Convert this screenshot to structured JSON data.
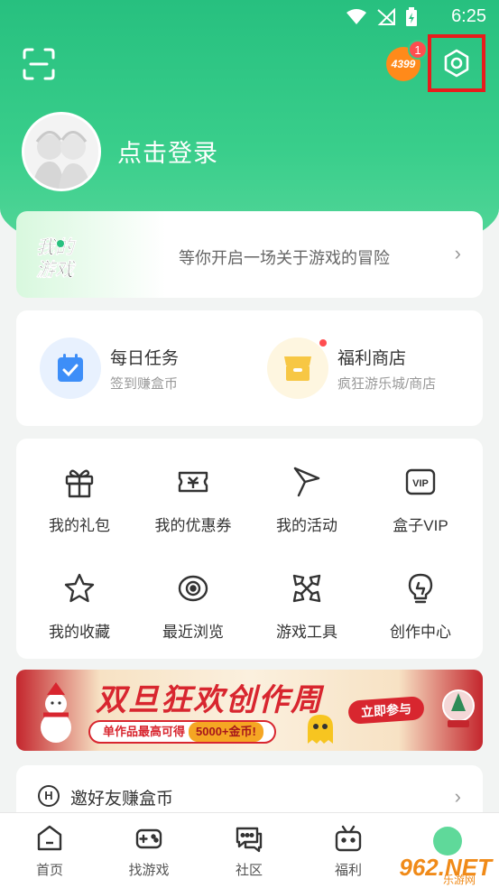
{
  "status_bar": {
    "time": "6:25"
  },
  "header": {
    "brand_logo": "4399",
    "notification_count": "1",
    "login_text": "点击登录"
  },
  "my_game": {
    "logo_text": "我的游戏",
    "tagline": "等你开启一场关于游戏的冒险",
    "chevron": "›"
  },
  "tasks": [
    {
      "title": "每日任务",
      "subtitle": "签到赚盒币",
      "icon": "calendar-check-icon",
      "color": "#3d8ef8"
    },
    {
      "title": "福利商店",
      "subtitle": "疯狂游乐城/商店",
      "icon": "shop-icon",
      "color": "#f7c744"
    }
  ],
  "grid": [
    {
      "label": "我的礼包",
      "icon": "gift-icon"
    },
    {
      "label": "我的优惠券",
      "icon": "coupon-icon"
    },
    {
      "label": "我的活动",
      "icon": "flag-icon"
    },
    {
      "label": "盒子VIP",
      "icon": "vip-icon"
    },
    {
      "label": "我的收藏",
      "icon": "star-icon"
    },
    {
      "label": "最近浏览",
      "icon": "eye-icon"
    },
    {
      "label": "游戏工具",
      "icon": "tools-icon"
    },
    {
      "label": "创作中心",
      "icon": "lightbulb-icon"
    }
  ],
  "banner": {
    "title": "双旦狂欢创作周",
    "subtitle": "单作品最高可得",
    "reward": "5000+金币!",
    "cta": "立即参与"
  },
  "invite": {
    "label": "邀好友赚盒币",
    "icon_letter": "H"
  },
  "bottom_nav": [
    {
      "label": "首页",
      "icon": "home-icon"
    },
    {
      "label": "找游戏",
      "icon": "gamepad-icon"
    },
    {
      "label": "社区",
      "icon": "chat-icon"
    },
    {
      "label": "福利",
      "icon": "gift-box-icon"
    }
  ],
  "watermark": {
    "main": "962.NET",
    "sub": "乐游网"
  },
  "colors": {
    "primary_green": "#27c07f",
    "highlight_red": "#e81c1c",
    "badge_red": "#ff4d4f"
  }
}
